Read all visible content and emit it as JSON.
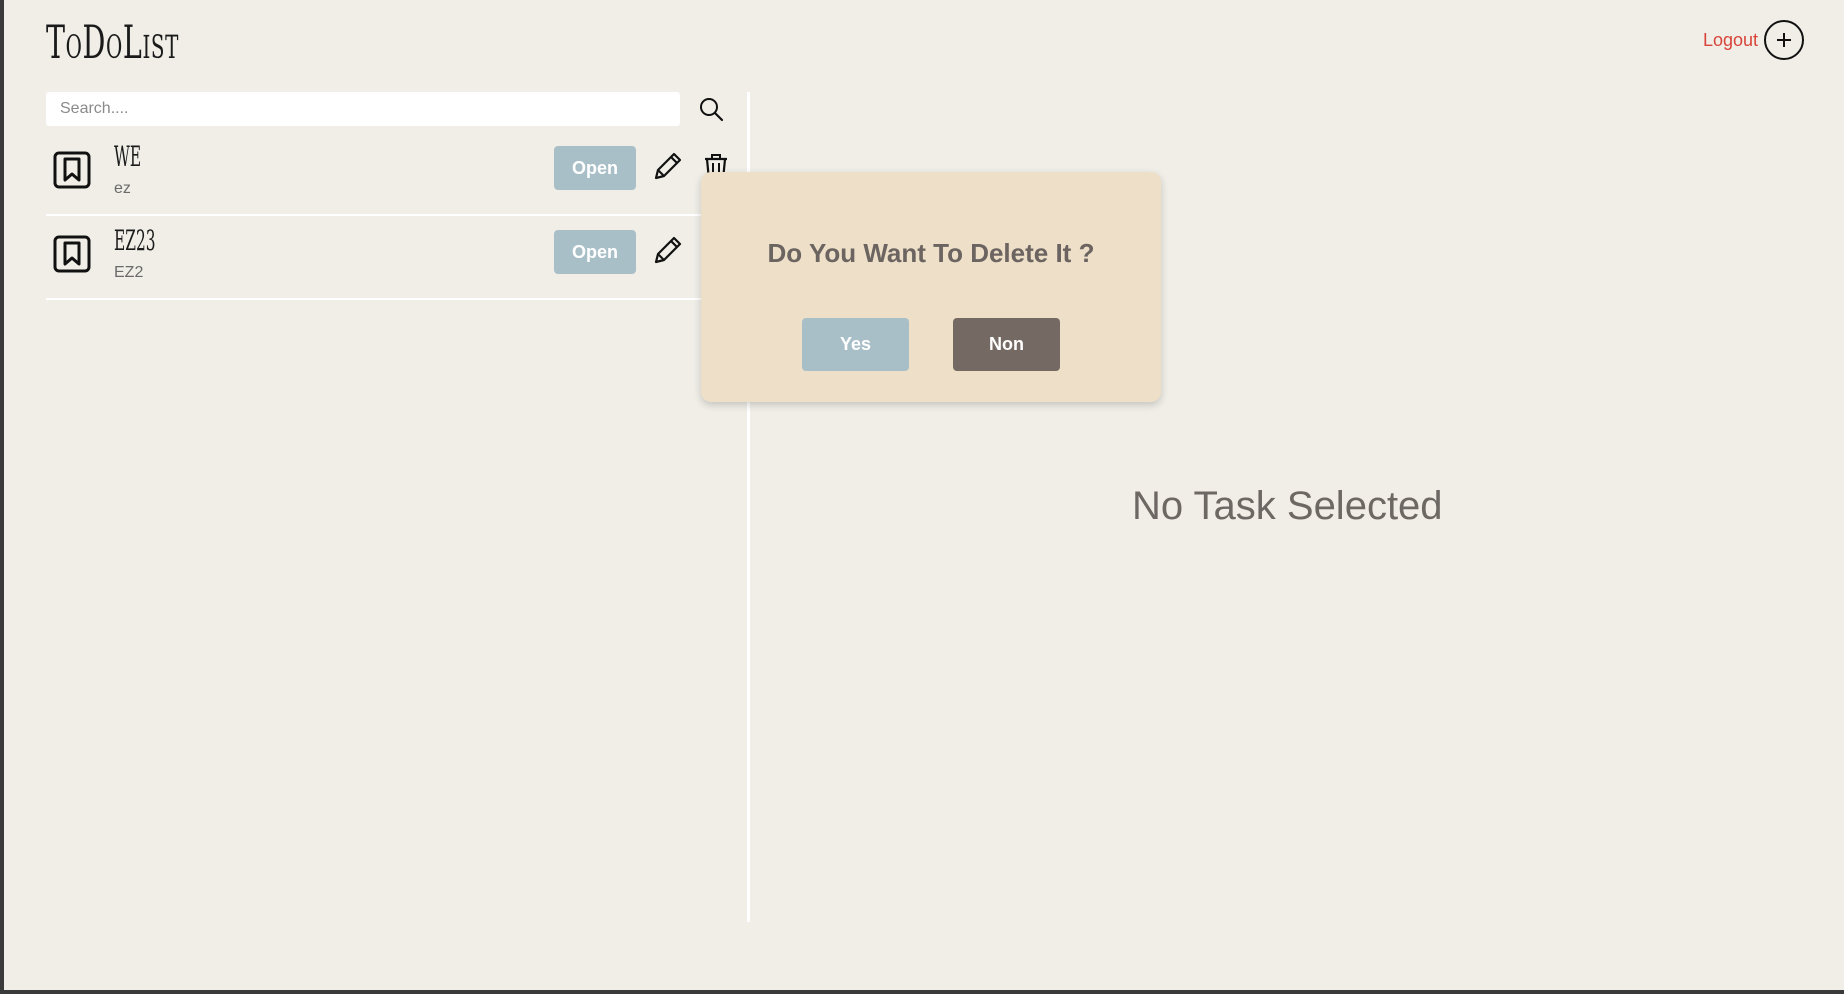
{
  "header": {
    "brand": "ToDoList",
    "logout_label": "Logout",
    "add_icon": "plus-circle-icon",
    "logout_color": "#d9443a"
  },
  "search": {
    "placeholder": "Search....",
    "value": "",
    "icon": "search-icon"
  },
  "tasks": [
    {
      "title": "WE",
      "subtitle": "ez",
      "open_label": "Open",
      "icon": "bookmark-icon",
      "has_edit": true,
      "has_delete": true
    },
    {
      "title": "EZ23",
      "subtitle": "EZ2",
      "open_label": "Open",
      "icon": "bookmark-icon",
      "has_edit": true,
      "has_delete": false
    }
  ],
  "main": {
    "empty_text": "No Task Selected"
  },
  "modal": {
    "question": "Do You Want To Delete It ?",
    "yes_label": "Yes",
    "no_label": "Non",
    "yes_color": "#a9bfc8",
    "no_color": "#756a63",
    "background": "#eddfc8"
  },
  "colors": {
    "page_bg": "#f0eee7",
    "accent_button": "#a9bfc8"
  }
}
